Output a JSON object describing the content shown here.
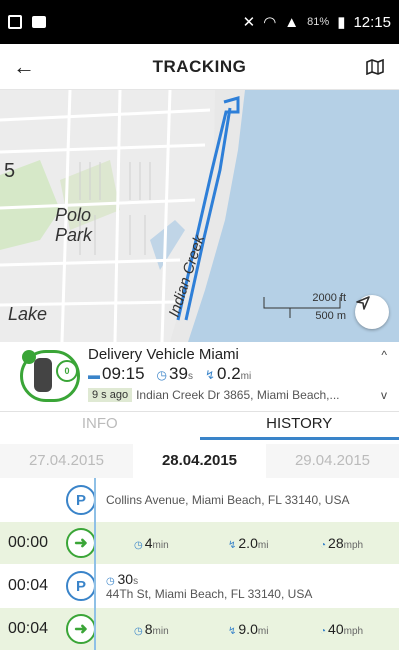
{
  "statusbar": {
    "battery": "81%",
    "time": "12:15"
  },
  "appbar": {
    "title": "TRACKING"
  },
  "map": {
    "area_label": "Polo\nPark",
    "lake_label": "Lake",
    "road_label": "Indian Creek",
    "scale_ft": "2000 ft",
    "scale_m": "500 m"
  },
  "vehicle": {
    "name": "Delivery Vehicle Miami",
    "speed": "0",
    "time": "09:15",
    "duration_value": "39",
    "duration_unit": "s",
    "distance_value": "0.2",
    "distance_unit": "mi",
    "ago": "9 s ago",
    "address": "Indian Creek Dr 3865, Miami Beach,..."
  },
  "tabs": [
    {
      "label": "INFO"
    },
    {
      "label": "HISTORY"
    }
  ],
  "dates": [
    {
      "label": "27.04.2015"
    },
    {
      "label": "28.04.2015"
    },
    {
      "label": "29.04.2015"
    }
  ],
  "history": {
    "first_stop_address": "Collins Avenue, Miami Beach, FL 33140, USA",
    "trip1": {
      "time": "00:00",
      "dur": "4",
      "dur_unit": "min",
      "dist": "2.0",
      "dist_unit": "mi",
      "speed": "28",
      "speed_unit": "mph"
    },
    "stop2": {
      "time": "00:04",
      "dur": "30",
      "dur_unit": "s",
      "address": "44Th St, Miami Beach, FL 33140, USA"
    },
    "trip2": {
      "time": "00:04",
      "dur": "8",
      "dur_unit": "min",
      "dist": "9.0",
      "dist_unit": "mi",
      "speed": "40",
      "speed_unit": "mph"
    }
  },
  "colors": {
    "accent_blue": "#3a84c9",
    "accent_green": "#3aa537",
    "trip_row_bg": "#eaf3df"
  },
  "icons": {
    "back": "arrow-left-icon",
    "map": "map-icon",
    "location": "navigation-arrow-icon",
    "parking": "parking-icon",
    "trip": "route-arrow-icon"
  }
}
